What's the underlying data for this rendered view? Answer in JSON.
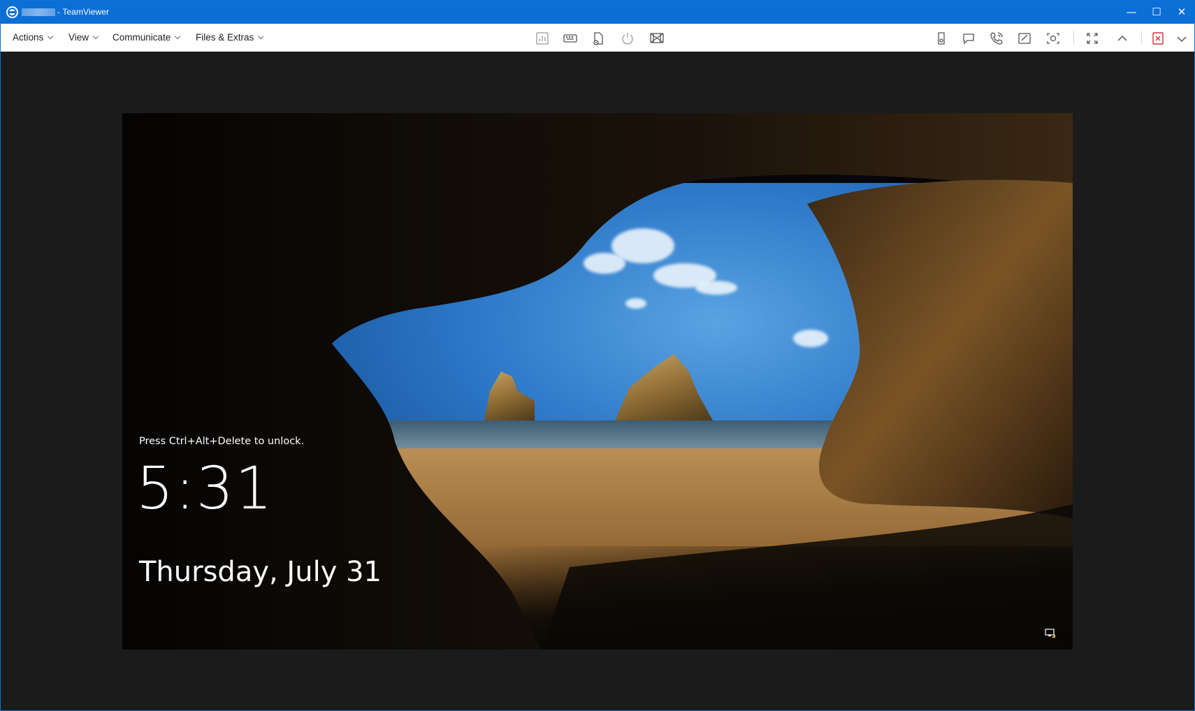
{
  "window": {
    "title": "- TeamViewer",
    "controls": {
      "minimize": "—",
      "maximize": "☐",
      "close": "✕"
    }
  },
  "menu": {
    "items": [
      {
        "label": "Actions"
      },
      {
        "label": "View"
      },
      {
        "label": "Communicate"
      },
      {
        "label": "Files & Extras"
      }
    ]
  },
  "toolbar": {
    "center_icons": [
      "dashboard-icon",
      "keyboard-icon",
      "file-transfer-icon",
      "power-icon",
      "disable-input-icon"
    ],
    "right_icons": [
      "session-icon",
      "chat-icon",
      "call-icon",
      "whiteboard-icon",
      "screenshot-icon",
      "fullscreen-icon",
      "collapse-icon",
      "end-session-icon",
      "more-chevron-icon"
    ]
  },
  "remote_screen": {
    "lock_hint": "Press Ctrl+Alt+Delete to unlock.",
    "time": "5:31",
    "date": "Thursday, July 31"
  },
  "colors": {
    "titlebar": "#0b6fd6",
    "background": "#1b1b1b",
    "end_session": "#d13438"
  }
}
